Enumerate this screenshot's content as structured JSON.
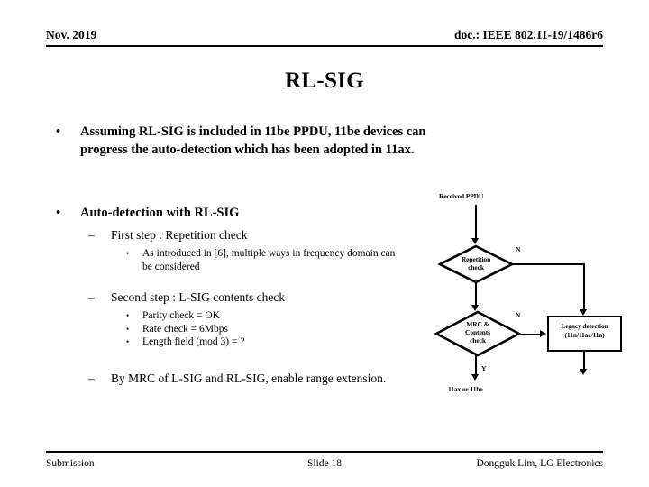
{
  "header": {
    "date": "Nov. 2019",
    "doc": "doc.: IEEE 802.11-19/1486r6"
  },
  "title": "RL-SIG",
  "body": {
    "intro_bullet_mark": "•",
    "intro": "Assuming RL-SIG is included in 11be PPDU, 11be devices can progress the auto-detection which has been adopted in 11ax.",
    "auto_bullet_mark": "•",
    "auto": "Auto-detection with RL-SIG",
    "dash_mark": "–",
    "sub_bullet_mark": "•",
    "first_step": "First step : Repetition check",
    "first_step_detail": "As introduced in [6], multiple ways in frequency domain can be considered",
    "second_step": "Second step : L-SIG contents check",
    "second_step_details": [
      "Parity check  = OK",
      "Rate check = 6Mbps",
      "Length field (mod 3) = ?"
    ],
    "third_step": "By MRC of L-SIG and RL-SIG, enable range extension."
  },
  "flowchart": {
    "input_label": "Received PPDU",
    "decision1": "Repetition check",
    "decision1_line1": "Repetition",
    "decision1_line2": "check",
    "decision1_no": "N",
    "decision2": "MRC & Contents check",
    "decision2_line1": "MRC &",
    "decision2_line2": "Contents",
    "decision2_line3": "check",
    "decision2_no": "N",
    "decision2_yes": "Y",
    "legacy_box_line1": "Legacy detection",
    "legacy_box_line2": "(11n/11ac/11a)",
    "output_label": "11ax or 11be"
  },
  "footer": {
    "left": "Submission",
    "center": "Slide 18",
    "right": "Dongguk Lim, LG Electronics"
  }
}
